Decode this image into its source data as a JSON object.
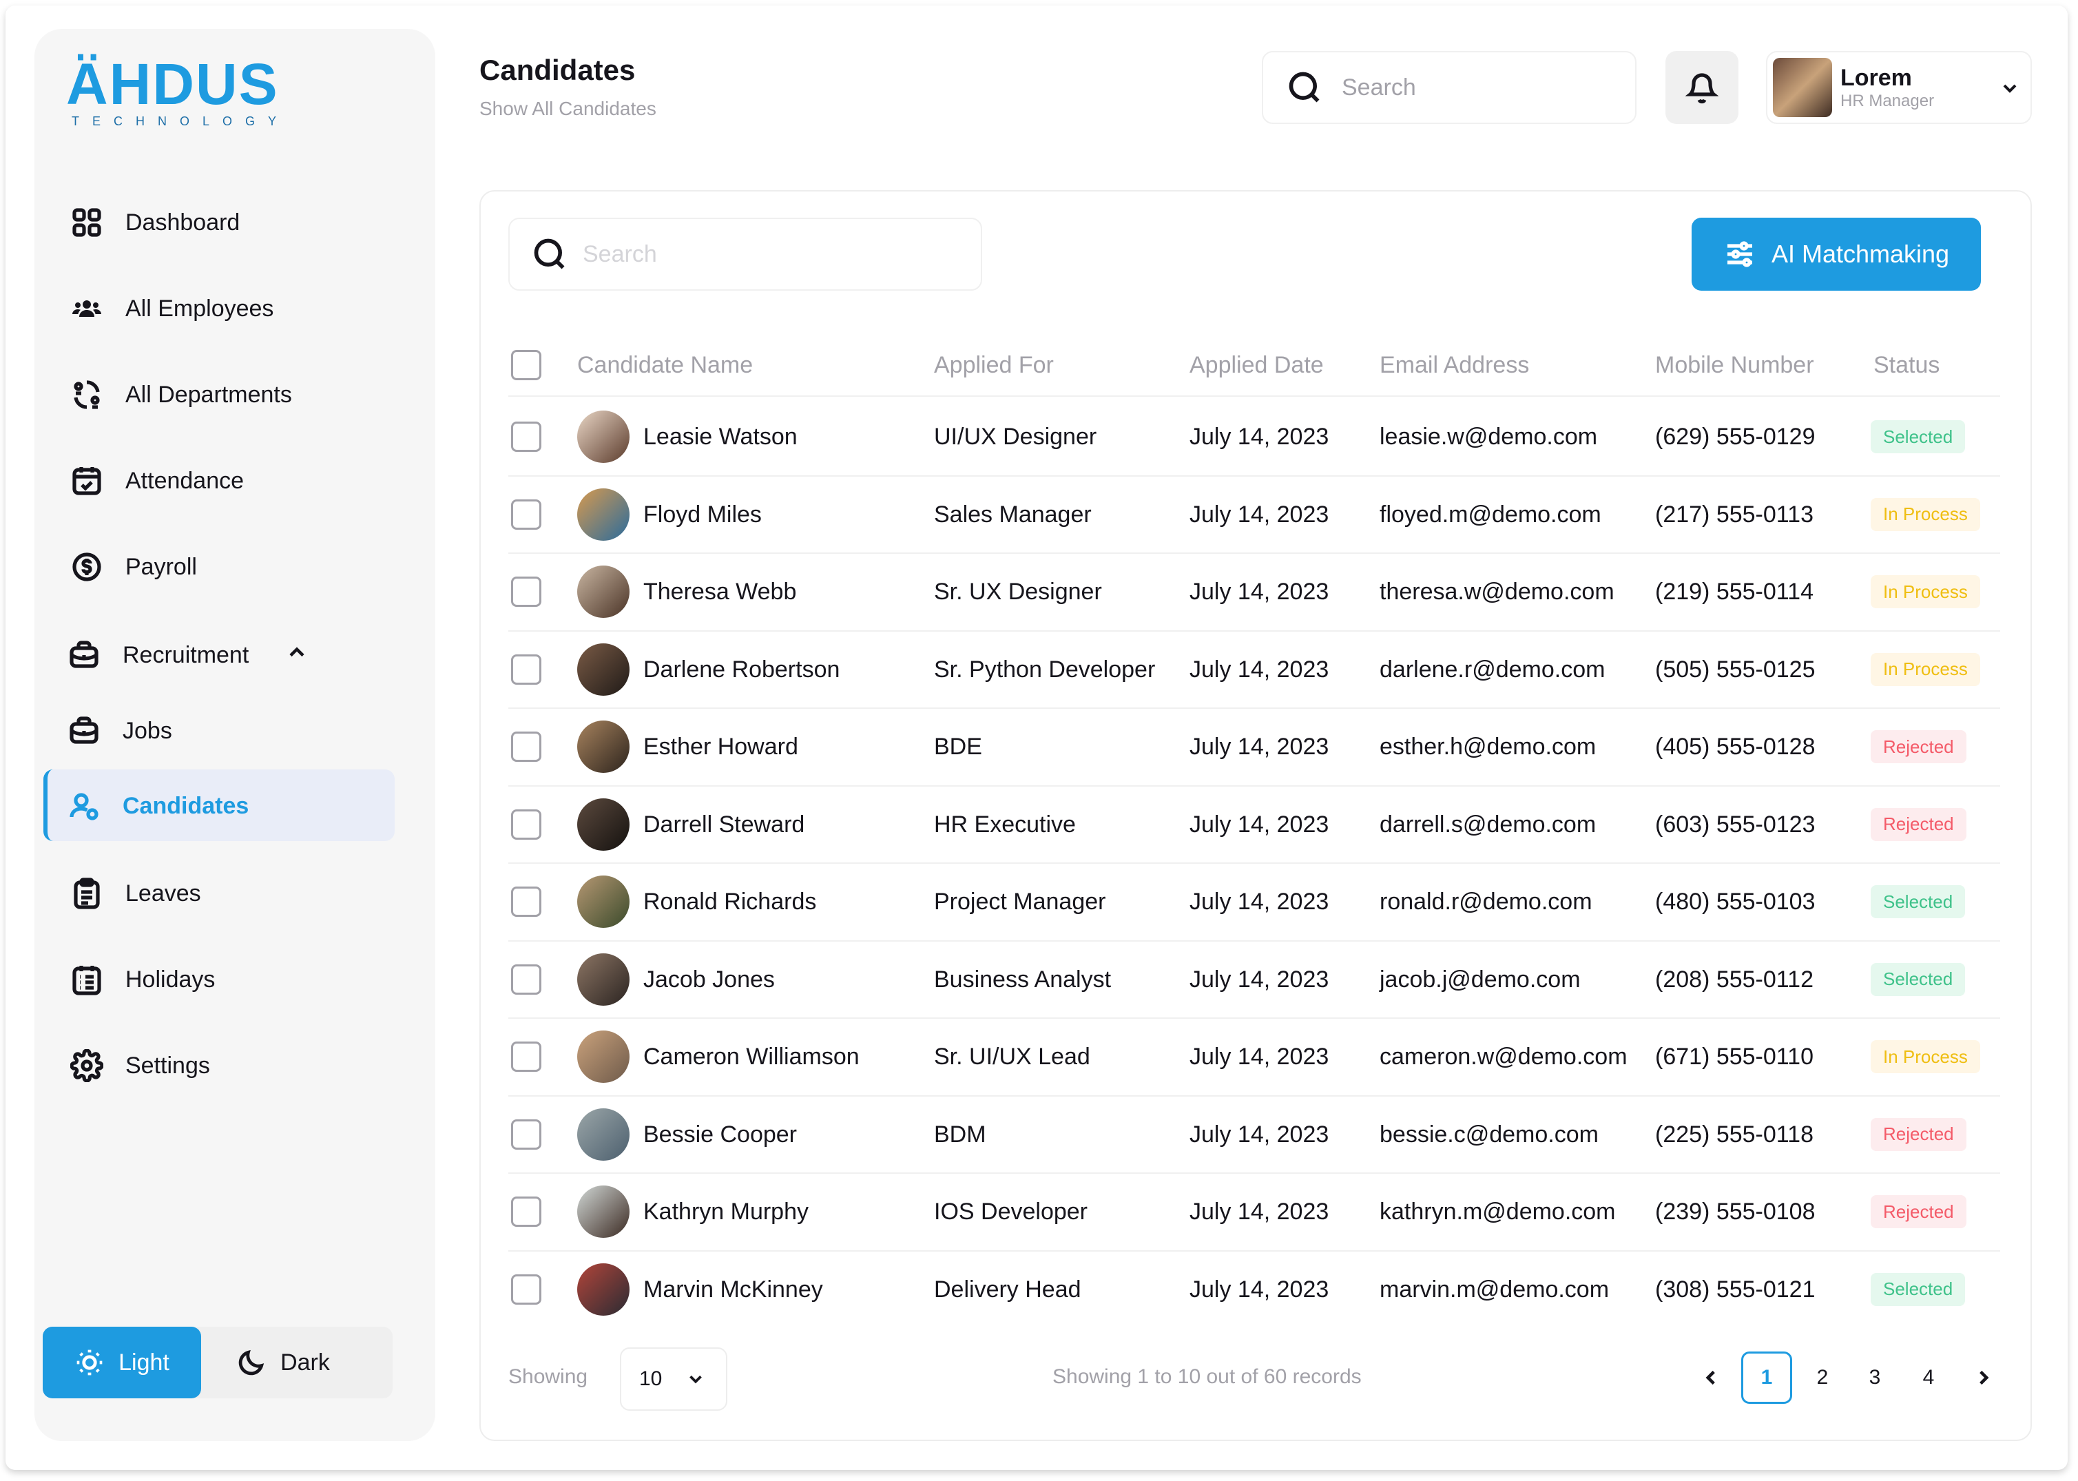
{
  "brand": {
    "name": "ÄHDUS",
    "tagline": "TECHNOLOGY"
  },
  "sidebar": {
    "items": [
      {
        "label": "Dashboard",
        "icon": "grid-icon"
      },
      {
        "label": "All Employees",
        "icon": "users-icon"
      },
      {
        "label": "All Departments",
        "icon": "departments-icon"
      },
      {
        "label": "Attendance",
        "icon": "calendar-check-icon"
      },
      {
        "label": "Payroll",
        "icon": "dollar-circle-icon"
      },
      {
        "label": "Recruitment",
        "icon": "briefcase-icon",
        "expanded": true
      },
      {
        "label": "Jobs",
        "icon": "briefcase-icon"
      },
      {
        "label": "Candidates",
        "icon": "user-group-icon",
        "active": true
      },
      {
        "label": "Leaves",
        "icon": "clipboard-icon"
      },
      {
        "label": "Holidays",
        "icon": "calendar-list-icon"
      },
      {
        "label": "Settings",
        "icon": "gear-icon"
      }
    ],
    "theme": {
      "light": "Light",
      "dark": "Dark",
      "selected": "Light"
    }
  },
  "header": {
    "title": "Candidates",
    "subtitle": "Show All Candidates",
    "search_placeholder": "Search",
    "user": {
      "name": "Lorem",
      "role": "HR Manager"
    }
  },
  "toolbar": {
    "search_placeholder": "Search",
    "ai_button": "AI Matchmaking"
  },
  "table": {
    "columns": [
      "Candidate Name",
      "Applied For",
      "Applied Date",
      "Email Address",
      "Mobile Number",
      "Status"
    ],
    "rows": [
      {
        "name": "Leasie Watson",
        "role": "UI/UX Designer",
        "date": "July 14, 2023",
        "email": "leasie.w@demo.com",
        "phone": "(629) 555-0129",
        "status": "Selected"
      },
      {
        "name": "Floyd Miles",
        "role": "Sales Manager",
        "date": "July 14, 2023",
        "email": "floyed.m@demo.com",
        "phone": "(217) 555-0113",
        "status": "In Process"
      },
      {
        "name": "Theresa Webb",
        "role": "Sr. UX Designer",
        "date": "July 14, 2023",
        "email": "theresa.w@demo.com",
        "phone": "(219) 555-0114",
        "status": "In Process"
      },
      {
        "name": "Darlene Robertson",
        "role": "Sr. Python Developer",
        "date": "July 14, 2023",
        "email": "darlene.r@demo.com",
        "phone": "(505) 555-0125",
        "status": "In Process"
      },
      {
        "name": "Esther Howard",
        "role": "BDE",
        "date": "July 14, 2023",
        "email": "esther.h@demo.com",
        "phone": "(405) 555-0128",
        "status": "Rejected"
      },
      {
        "name": "Darrell Steward",
        "role": "HR Executive",
        "date": "July 14, 2023",
        "email": "darrell.s@demo.com",
        "phone": "(603) 555-0123",
        "status": "Rejected"
      },
      {
        "name": "Ronald Richards",
        "role": "Project Manager",
        "date": "July 14, 2023",
        "email": "ronald.r@demo.com",
        "phone": "(480) 555-0103",
        "status": "Selected"
      },
      {
        "name": "Jacob Jones",
        "role": "Business Analyst",
        "date": "July 14, 2023",
        "email": "jacob.j@demo.com",
        "phone": "(208) 555-0112",
        "status": "Selected"
      },
      {
        "name": "Cameron Williamson",
        "role": "Sr. UI/UX Lead",
        "date": "July 14, 2023",
        "email": "cameron.w@demo.com",
        "phone": "(671) 555-0110",
        "status": "In Process"
      },
      {
        "name": "Bessie Cooper",
        "role": "BDM",
        "date": "July 14, 2023",
        "email": "bessie.c@demo.com",
        "phone": "(225) 555-0118",
        "status": "Rejected"
      },
      {
        "name": "Kathryn Murphy",
        "role": "IOS Developer",
        "date": "July 14, 2023",
        "email": "kathryn.m@demo.com",
        "phone": "(239) 555-0108",
        "status": "Rejected"
      },
      {
        "name": "Marvin McKinney",
        "role": "Delivery Head",
        "date": "July 14, 2023",
        "email": "marvin.m@demo.com",
        "phone": "(308) 555-0121",
        "status": "Selected"
      }
    ]
  },
  "footer": {
    "showing_label": "Showing",
    "per_page": "10",
    "records_text": "Showing 1 to 10 out of 60 records",
    "pages": [
      "1",
      "2",
      "3",
      "4"
    ],
    "current_page": "1"
  },
  "colors": {
    "accent": "#1E9BE0",
    "selected": "#3FC28A",
    "in_process": "#EFBE12",
    "rejected": "#F45B69"
  }
}
